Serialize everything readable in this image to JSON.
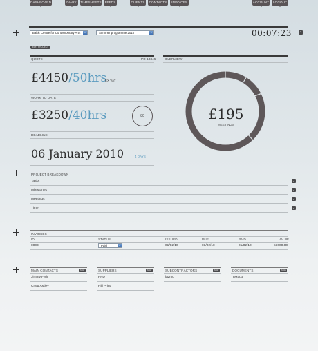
{
  "nav": {
    "left": [
      "DASHBOARD",
      "DIARY",
      "TIMESHEETS",
      "FEEDS",
      "CLIENTS",
      "CONTACTS",
      "INVOICES"
    ],
    "right": [
      "ACCOUNT",
      "LOGOUT"
    ]
  },
  "header": {
    "client_select": "Baltic Centre for Contemporary Arts",
    "project_select": "Summer programme 2010",
    "timer": "00:07:23",
    "edit_button": "EDIT PROJECT"
  },
  "quote": {
    "label": "QUOTE",
    "po": "PO 13345",
    "amount": "£4450",
    "hours": "/50hrs",
    "vat": "EX VAT"
  },
  "work_to_date": {
    "label": "WORK TO DATE",
    "amount": "£3250",
    "hours": "/40hrs",
    "circle_value": "80"
  },
  "deadline": {
    "label": "DEADLINE",
    "date": "06 January 2010",
    "days": "4 DAYS"
  },
  "overview": {
    "label": "OVERVIEW",
    "value": "£195",
    "caption": "MEETINGS",
    "ring_color": "#5e5759"
  },
  "breakdown": {
    "label": "PROJECT BREAKDOWN",
    "items": [
      "Tasks",
      "Milestones",
      "Meetings",
      "Time"
    ]
  },
  "invoices": {
    "label": "INVOICES",
    "columns": [
      "ID",
      "STATUS",
      "ISSUED",
      "DUE",
      "PAID",
      "VALUE"
    ],
    "rows": [
      {
        "id": "0003",
        "status": "Paid",
        "issued": "01/02/10",
        "due": "01/02/10",
        "paid": "01/02/10",
        "value": "£3000.00"
      }
    ]
  },
  "contacts": {
    "main": {
      "label": "MAIN CONTACTS",
      "add": "ADD",
      "items": [
        "Jimmy Fish",
        "Craig Astley"
      ]
    },
    "suppliers": {
      "label": "SUPPLIERS",
      "add": "ADD",
      "items": [
        "PPD",
        "Hill Print"
      ]
    },
    "subcontractors": {
      "label": "SUBCONTRACTORS",
      "add": "ADD",
      "items": [
        "lazmo"
      ]
    },
    "documents": {
      "label": "DOCUMENTS",
      "add": "ADD",
      "items": [
        "Text.txt"
      ]
    }
  },
  "colors": {
    "accent": "#5b9bbf",
    "dark": "#4a4a4c"
  }
}
